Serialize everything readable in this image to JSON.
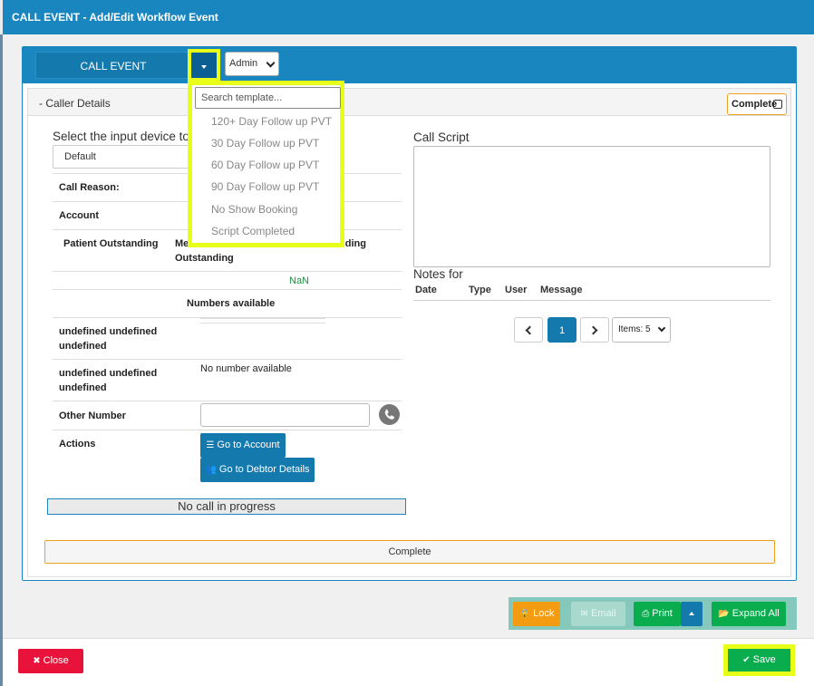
{
  "modal": {
    "title": "CALL EVENT - Add/Edit Workflow Event"
  },
  "header": {
    "call_event_label": "CALL EVENT",
    "admin_value": "Admin"
  },
  "caller": {
    "section_title": "Caller Details",
    "section_toggle": "-",
    "complete_label": "Complete",
    "input_device_label": "Select the input device to",
    "input_device_value": "Default",
    "call_reason_label": "Call Reason:",
    "account_label": "Account",
    "patient_outstanding_label": "Patient Outstanding",
    "medical_aid_label_1": "Me",
    "medical_aid_label_2": "Outstanding",
    "outstanding_label_partial": "nding",
    "nan_value": "NaN",
    "numbers_available_label": "Numbers available",
    "undefined_1_line1": "undefined undefined",
    "undefined_1_line2": "undefined",
    "undefined_2_line1": "undefined undefined",
    "undefined_2_line2": "undefined",
    "no_number_text": "No number available",
    "other_number_label": "Other Number",
    "actions_label": "Actions",
    "go_to_account_label": "Go to Account",
    "go_to_debtor_label": "Go to Debtor Details",
    "no_call_text": "No call in progress",
    "complete_bar_label": "Complete"
  },
  "script": {
    "call_script_label": "Call Script",
    "notes_label": "Notes for",
    "columns": [
      "Date",
      "Type",
      "User",
      "Message"
    ],
    "page_current": "1",
    "items_value": "Items: 5"
  },
  "dropdown": {
    "search_placeholder": "Search template...",
    "items": [
      "120+ Day Follow up PVT",
      "30 Day Follow up PVT",
      "60 Day Follow up PVT",
      "90 Day Follow up PVT",
      "No Show Booking",
      "Script Completed"
    ]
  },
  "actions": {
    "lock_label": "Lock",
    "email_label": "Email",
    "print_label": "Print",
    "expand_label": "Expand All"
  },
  "footer": {
    "close_label": "Close",
    "save_label": "Save"
  },
  "colors": {
    "brand_blue": "#1a86c0",
    "highlight_yellow": "#e8ff1a",
    "success_green": "#0aad4e",
    "danger_red": "#e8123a",
    "warning_orange": "#f39c12"
  },
  "icons": [
    "caret-down-icon",
    "chevron-down-icon",
    "checkbox-icon",
    "phone-icon",
    "list-icon",
    "users-icon",
    "chevron-left-icon",
    "chevron-right-icon",
    "lock-icon",
    "envelope-icon",
    "print-icon",
    "caret-up-icon",
    "folder-open-icon",
    "times-circle-icon",
    "check-circle-icon"
  ]
}
